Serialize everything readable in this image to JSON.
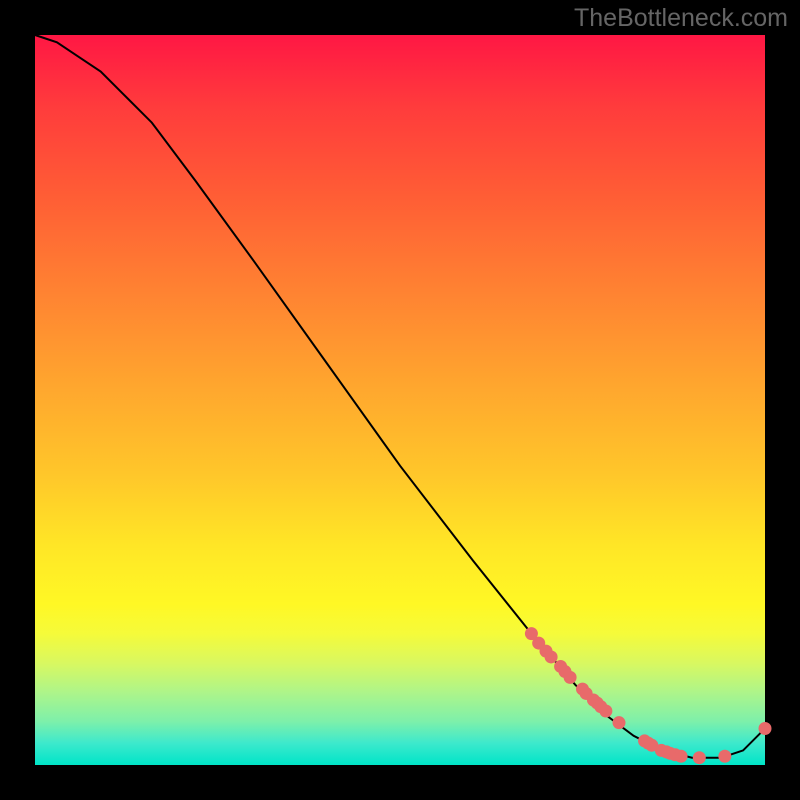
{
  "watermark": "TheBottleneck.com",
  "chart_data": {
    "type": "line",
    "title": "",
    "xlabel": "",
    "ylabel": "",
    "xlim": [
      0,
      100
    ],
    "ylim": [
      0,
      100
    ],
    "curve": {
      "x": [
        0,
        3,
        6,
        9,
        12,
        16,
        22,
        30,
        40,
        50,
        60,
        68,
        74,
        78,
        82,
        86,
        90,
        94,
        97,
        100
      ],
      "y": [
        100,
        99,
        97,
        95,
        92,
        88,
        80,
        69,
        55,
        41,
        28,
        18,
        11,
        7,
        4,
        2,
        1,
        1,
        2,
        5
      ]
    },
    "markers": [
      {
        "x": 68.0,
        "y": 18.0
      },
      {
        "x": 69.0,
        "y": 16.7
      },
      {
        "x": 70.0,
        "y": 15.6
      },
      {
        "x": 70.7,
        "y": 14.8
      },
      {
        "x": 72.0,
        "y": 13.5
      },
      {
        "x": 72.6,
        "y": 12.8
      },
      {
        "x": 73.3,
        "y": 12.0
      },
      {
        "x": 75.0,
        "y": 10.4
      },
      {
        "x": 75.5,
        "y": 9.8
      },
      {
        "x": 76.5,
        "y": 8.9
      },
      {
        "x": 77.0,
        "y": 8.5
      },
      {
        "x": 77.5,
        "y": 8.0
      },
      {
        "x": 78.2,
        "y": 7.4
      },
      {
        "x": 80.0,
        "y": 5.8
      },
      {
        "x": 83.5,
        "y": 3.3
      },
      {
        "x": 84.0,
        "y": 3.0
      },
      {
        "x": 84.5,
        "y": 2.7
      },
      {
        "x": 85.8,
        "y": 2.0
      },
      {
        "x": 86.5,
        "y": 1.8
      },
      {
        "x": 87.0,
        "y": 1.6
      },
      {
        "x": 87.7,
        "y": 1.4
      },
      {
        "x": 88.5,
        "y": 1.2
      },
      {
        "x": 91.0,
        "y": 1.0
      },
      {
        "x": 94.5,
        "y": 1.2
      },
      {
        "x": 100.0,
        "y": 5.0
      }
    ],
    "marker_color": "#e86a6a",
    "curve_color": "#000000"
  }
}
